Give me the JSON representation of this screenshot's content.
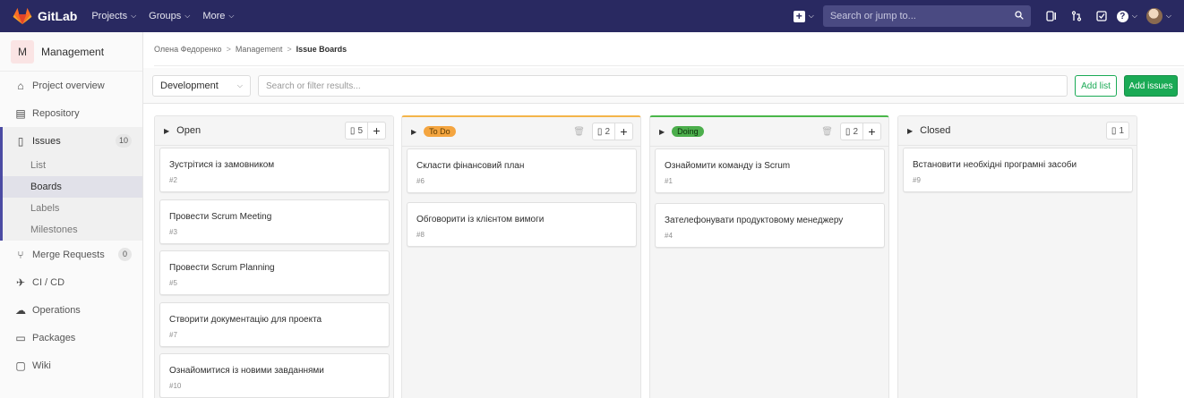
{
  "navbar": {
    "brand": "GitLab",
    "menus": [
      {
        "label": "Projects"
      },
      {
        "label": "Groups"
      },
      {
        "label": "More"
      }
    ],
    "search_placeholder": "Search or jump to...",
    "colors": {
      "bg": "#292961",
      "search_bg": "#4a4a82"
    }
  },
  "sidebar": {
    "project_initial": "M",
    "project_name": "Management",
    "items": [
      {
        "label": "Project overview",
        "icon": "home-icon"
      },
      {
        "label": "Repository",
        "icon": "book-icon"
      },
      {
        "label": "Issues",
        "icon": "issues-icon",
        "count": "10"
      },
      {
        "label": "Merge Requests",
        "icon": "merge-request-icon",
        "count": "0"
      },
      {
        "label": "CI / CD",
        "icon": "rocket-icon"
      },
      {
        "label": "Operations",
        "icon": "cloud-icon"
      },
      {
        "label": "Packages",
        "icon": "package-icon"
      },
      {
        "label": "Wiki",
        "icon": "wiki-icon"
      }
    ],
    "issue_subitems": [
      {
        "label": "List"
      },
      {
        "label": "Boards"
      },
      {
        "label": "Labels"
      },
      {
        "label": "Milestones"
      }
    ]
  },
  "breadcrumb": {
    "items": [
      "Олена Федоренко",
      "Management",
      "Issue Boards"
    ]
  },
  "filterbar": {
    "board_select": "Development",
    "filter_placeholder": "Search or filter results...",
    "add_list_label": "Add list",
    "add_issues_label": "Add issues"
  },
  "board": {
    "lists": [
      {
        "title": "Open",
        "count": "5",
        "cards": [
          {
            "title": "Зустрітися із замовником",
            "id": "#2"
          },
          {
            "title": "Провести Scrum Meeting",
            "id": "#3"
          },
          {
            "title": "Провести Scrum Planning",
            "id": "#5"
          },
          {
            "title": "Створити документацію для проекта",
            "id": "#7"
          },
          {
            "title": "Ознайомитися із новими завданнями",
            "id": "#10"
          }
        ]
      },
      {
        "title": "To Do",
        "label_color": "#f4a540",
        "count": "2",
        "cards": [
          {
            "title": "Скласти фінансовий план",
            "id": "#6"
          },
          {
            "title": "Обговорити із клієнтом вимоги",
            "id": "#8"
          }
        ]
      },
      {
        "title": "Doing",
        "label_color": "#4cae4c",
        "count": "2",
        "cards": [
          {
            "title": "Ознайомити команду із Scrum",
            "id": "#1"
          },
          {
            "title": "Зателефонувати продуктовому менеджеру",
            "id": "#4"
          }
        ]
      },
      {
        "title": "Closed",
        "count": "1",
        "cards": [
          {
            "title": "Встановити необхідні програмні засоби",
            "id": "#9"
          }
        ]
      }
    ]
  }
}
